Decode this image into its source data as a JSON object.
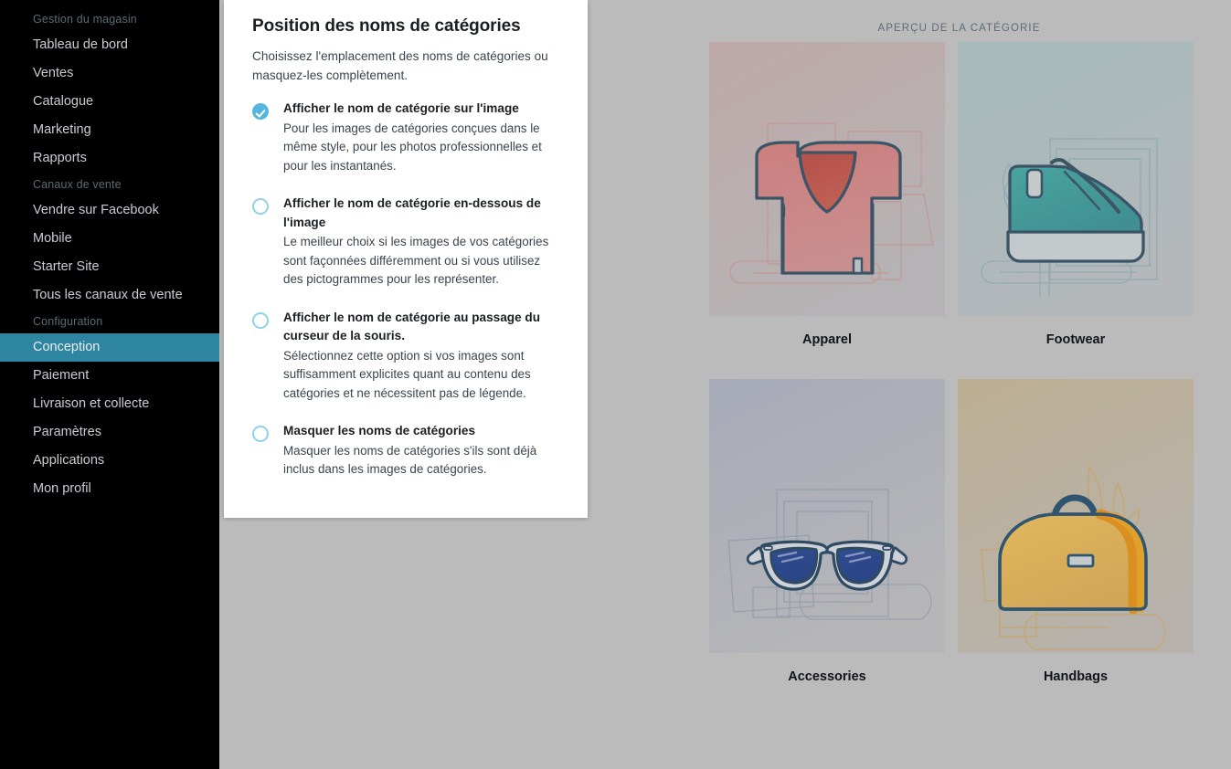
{
  "sidebar": {
    "groups": [
      {
        "title": "Gestion du magasin",
        "items": [
          {
            "label": "Tableau de bord",
            "active": false
          },
          {
            "label": "Ventes",
            "active": false
          },
          {
            "label": "Catalogue",
            "active": false
          },
          {
            "label": "Marketing",
            "active": false
          },
          {
            "label": "Rapports",
            "active": false
          }
        ]
      },
      {
        "title": "Canaux de vente",
        "items": [
          {
            "label": "Vendre sur Facebook",
            "active": false
          },
          {
            "label": "Mobile",
            "active": false
          },
          {
            "label": "Starter Site",
            "active": false
          },
          {
            "label": "Tous les canaux de vente",
            "active": false
          }
        ]
      },
      {
        "title": "Configuration",
        "items": [
          {
            "label": "Conception",
            "active": true
          },
          {
            "label": "Paiement",
            "active": false
          },
          {
            "label": "Livraison et collecte",
            "active": false
          },
          {
            "label": "Paramètres",
            "active": false
          },
          {
            "label": "Applications",
            "active": false
          },
          {
            "label": "Mon profil",
            "active": false
          }
        ]
      }
    ],
    "active_color": "#2d85a0"
  },
  "panel": {
    "title": "Position des noms de catégories",
    "subtitle": "Choisissez l'emplacement des noms de catégories ou masquez-les complètement.",
    "accent_color": "#54b6de",
    "options": [
      {
        "id": "on-image",
        "title": "Afficher le nom de catégorie sur l'image",
        "description": "Pour les images de catégories conçues dans le même style, pour les photos professionnelles et pour les instantanés.",
        "selected": true
      },
      {
        "id": "below-image",
        "title": "Afficher le nom de catégorie en-dessous de l'image",
        "description": "Le meilleur choix si les images de vos catégories sont façonnées différemment ou si vous utilisez des pictogrammes pour les représenter.",
        "selected": false
      },
      {
        "id": "on-hover",
        "title": "Afficher le nom de catégorie au passage du curseur de la souris.",
        "description": "Sélectionnez cette option si vos images sont suffisamment explicites quant au contenu des catégories et ne nécessitent pas de légende.",
        "selected": false
      },
      {
        "id": "hide",
        "title": "Masquer les noms de catégories",
        "description": "Masquer les noms de catégories s'ils sont déjà inclus dans les images de catégories.",
        "selected": false
      }
    ]
  },
  "preview": {
    "title": "APERÇU DE LA CATÉGORIE",
    "cards": [
      {
        "label": "Apparel",
        "icon": "tshirt-icon",
        "bg_from": "#bcaaa9",
        "bg_to": "#b4b2b4"
      },
      {
        "label": "Footwear",
        "icon": "sneaker-icon",
        "bg_from": "#a8bcbd",
        "bg_to": "#b3b7ba"
      },
      {
        "label": "Accessories",
        "icon": "sunglasses-icon",
        "bg_from": "#a9acb9",
        "bg_to": "#b6b6b8"
      },
      {
        "label": "Handbags",
        "icon": "handbag-icon",
        "bg_from": "#bbae94",
        "bg_to": "#b6b2ac"
      }
    ]
  }
}
